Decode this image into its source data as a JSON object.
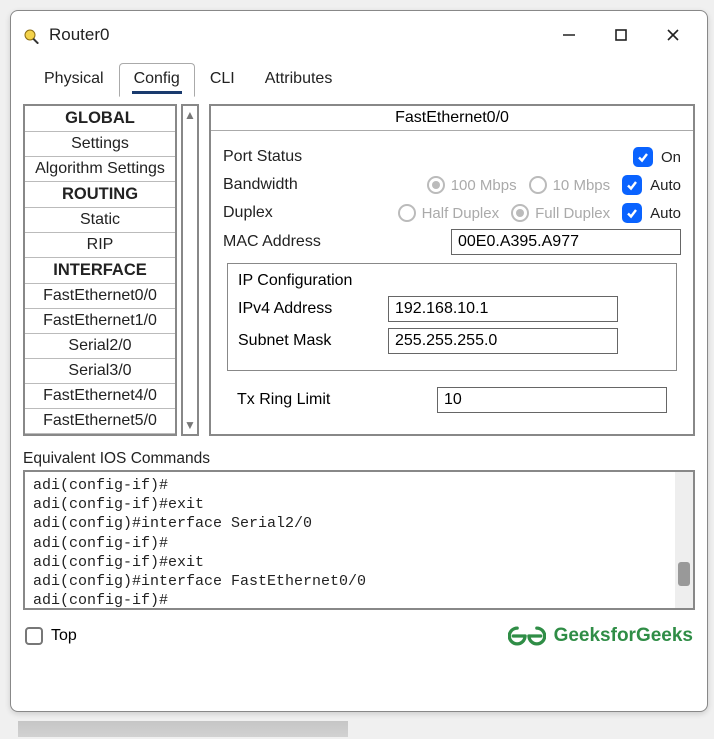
{
  "window": {
    "title": "Router0"
  },
  "tabs": {
    "physical": "Physical",
    "config": "Config",
    "cli": "CLI",
    "attributes": "Attributes",
    "active": "config"
  },
  "sidebar": {
    "global": "GLOBAL",
    "settings": "Settings",
    "algorithm": "Algorithm Settings",
    "routing": "ROUTING",
    "static": "Static",
    "rip": "RIP",
    "interface": "INTERFACE",
    "fe00": "FastEthernet0/0",
    "fe10": "FastEthernet1/0",
    "s20": "Serial2/0",
    "s30": "Serial3/0",
    "fe40": "FastEthernet4/0",
    "fe50": "FastEthernet5/0"
  },
  "detail": {
    "title": "FastEthernet0/0",
    "port_status_label": "Port Status",
    "on_label": "On",
    "bandwidth_label": "Bandwidth",
    "bw_100": "100 Mbps",
    "bw_10": "10 Mbps",
    "auto_label": "Auto",
    "duplex_label": "Duplex",
    "half": "Half Duplex",
    "full": "Full Duplex",
    "mac_label": "MAC Address",
    "mac_value": "00E0.A395.A977",
    "ipconf_label": "IP Configuration",
    "ipv4_label": "IPv4 Address",
    "ipv4_value": "192.168.10.1",
    "subnet_label": "Subnet Mask",
    "subnet_value": "255.255.255.0",
    "txring_label": "Tx Ring Limit",
    "txring_value": "10"
  },
  "ios": {
    "heading": "Equivalent IOS Commands",
    "text": "adi(config-if)#\nadi(config-if)#exit\nadi(config)#interface Serial2/0\nadi(config-if)#\nadi(config-if)#exit\nadi(config)#interface FastEthernet0/0\nadi(config-if)#"
  },
  "footer": {
    "top": "Top",
    "brand": "GeeksforGeeks"
  }
}
